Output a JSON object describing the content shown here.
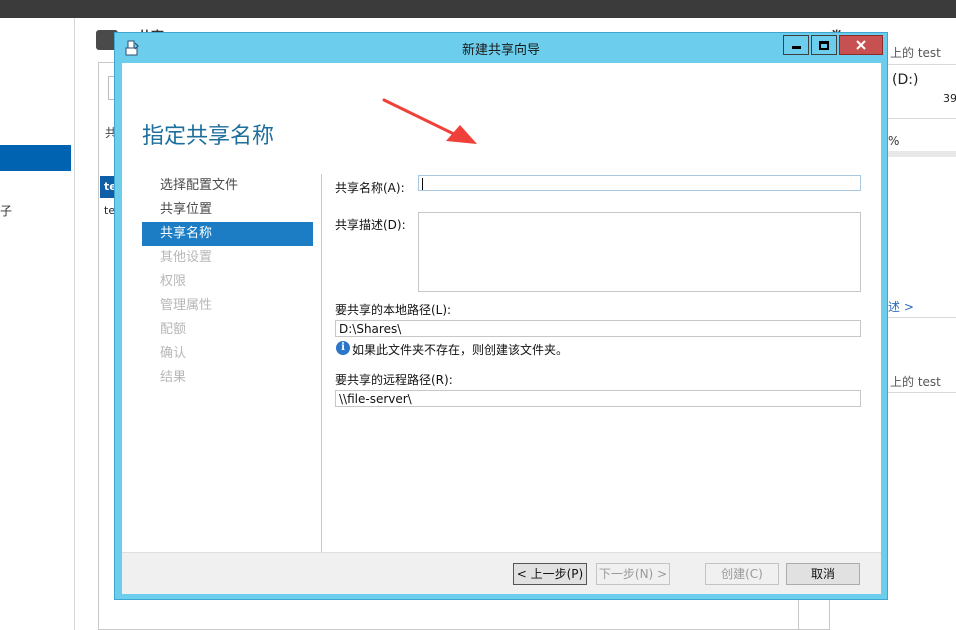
{
  "background": {
    "header_title": "共享",
    "volume_title": "卷",
    "share_list_label": "共",
    "selected_row_text": "te",
    "second_row_text": "te",
    "nav_fragment": "子"
  },
  "right_panel": {
    "line1": "上的 test",
    "drive": "(D:)",
    "number": "39",
    "percent": "%",
    "link": "述 >",
    "line2": "上的 test"
  },
  "window": {
    "title": "新建共享向导"
  },
  "wizard": {
    "heading": "指定共享名称",
    "steps": [
      {
        "label": "选择配置文件",
        "state": "normal"
      },
      {
        "label": "共享位置",
        "state": "normal"
      },
      {
        "label": "共享名称",
        "state": "active"
      },
      {
        "label": "其他设置",
        "state": "disabled"
      },
      {
        "label": "权限",
        "state": "disabled"
      },
      {
        "label": "管理属性",
        "state": "disabled"
      },
      {
        "label": "配额",
        "state": "disabled"
      },
      {
        "label": "确认",
        "state": "disabled"
      },
      {
        "label": "结果",
        "state": "disabled"
      }
    ],
    "share_name_label": "共享名称(A):",
    "share_name_value": "",
    "share_desc_label": "共享描述(D):",
    "share_desc_value": "",
    "local_path_label": "要共享的本地路径(L):",
    "local_path_value": "D:\\Shares\\",
    "info_text": "如果此文件夹不存在，则创建该文件夹。",
    "remote_path_label": "要共享的远程路径(R):",
    "remote_path_value": "\\\\file-server\\"
  },
  "buttons": {
    "prev": "< 上一步(P)",
    "next": "下一步(N) >",
    "create": "创建(C)",
    "cancel": "取消"
  },
  "colors": {
    "title_bar": "#6ccdec",
    "heading": "#1e6f9c",
    "active_step": "#1c7dc4",
    "close_button": "#c75050",
    "annotation_arrow": "#f0403a"
  }
}
